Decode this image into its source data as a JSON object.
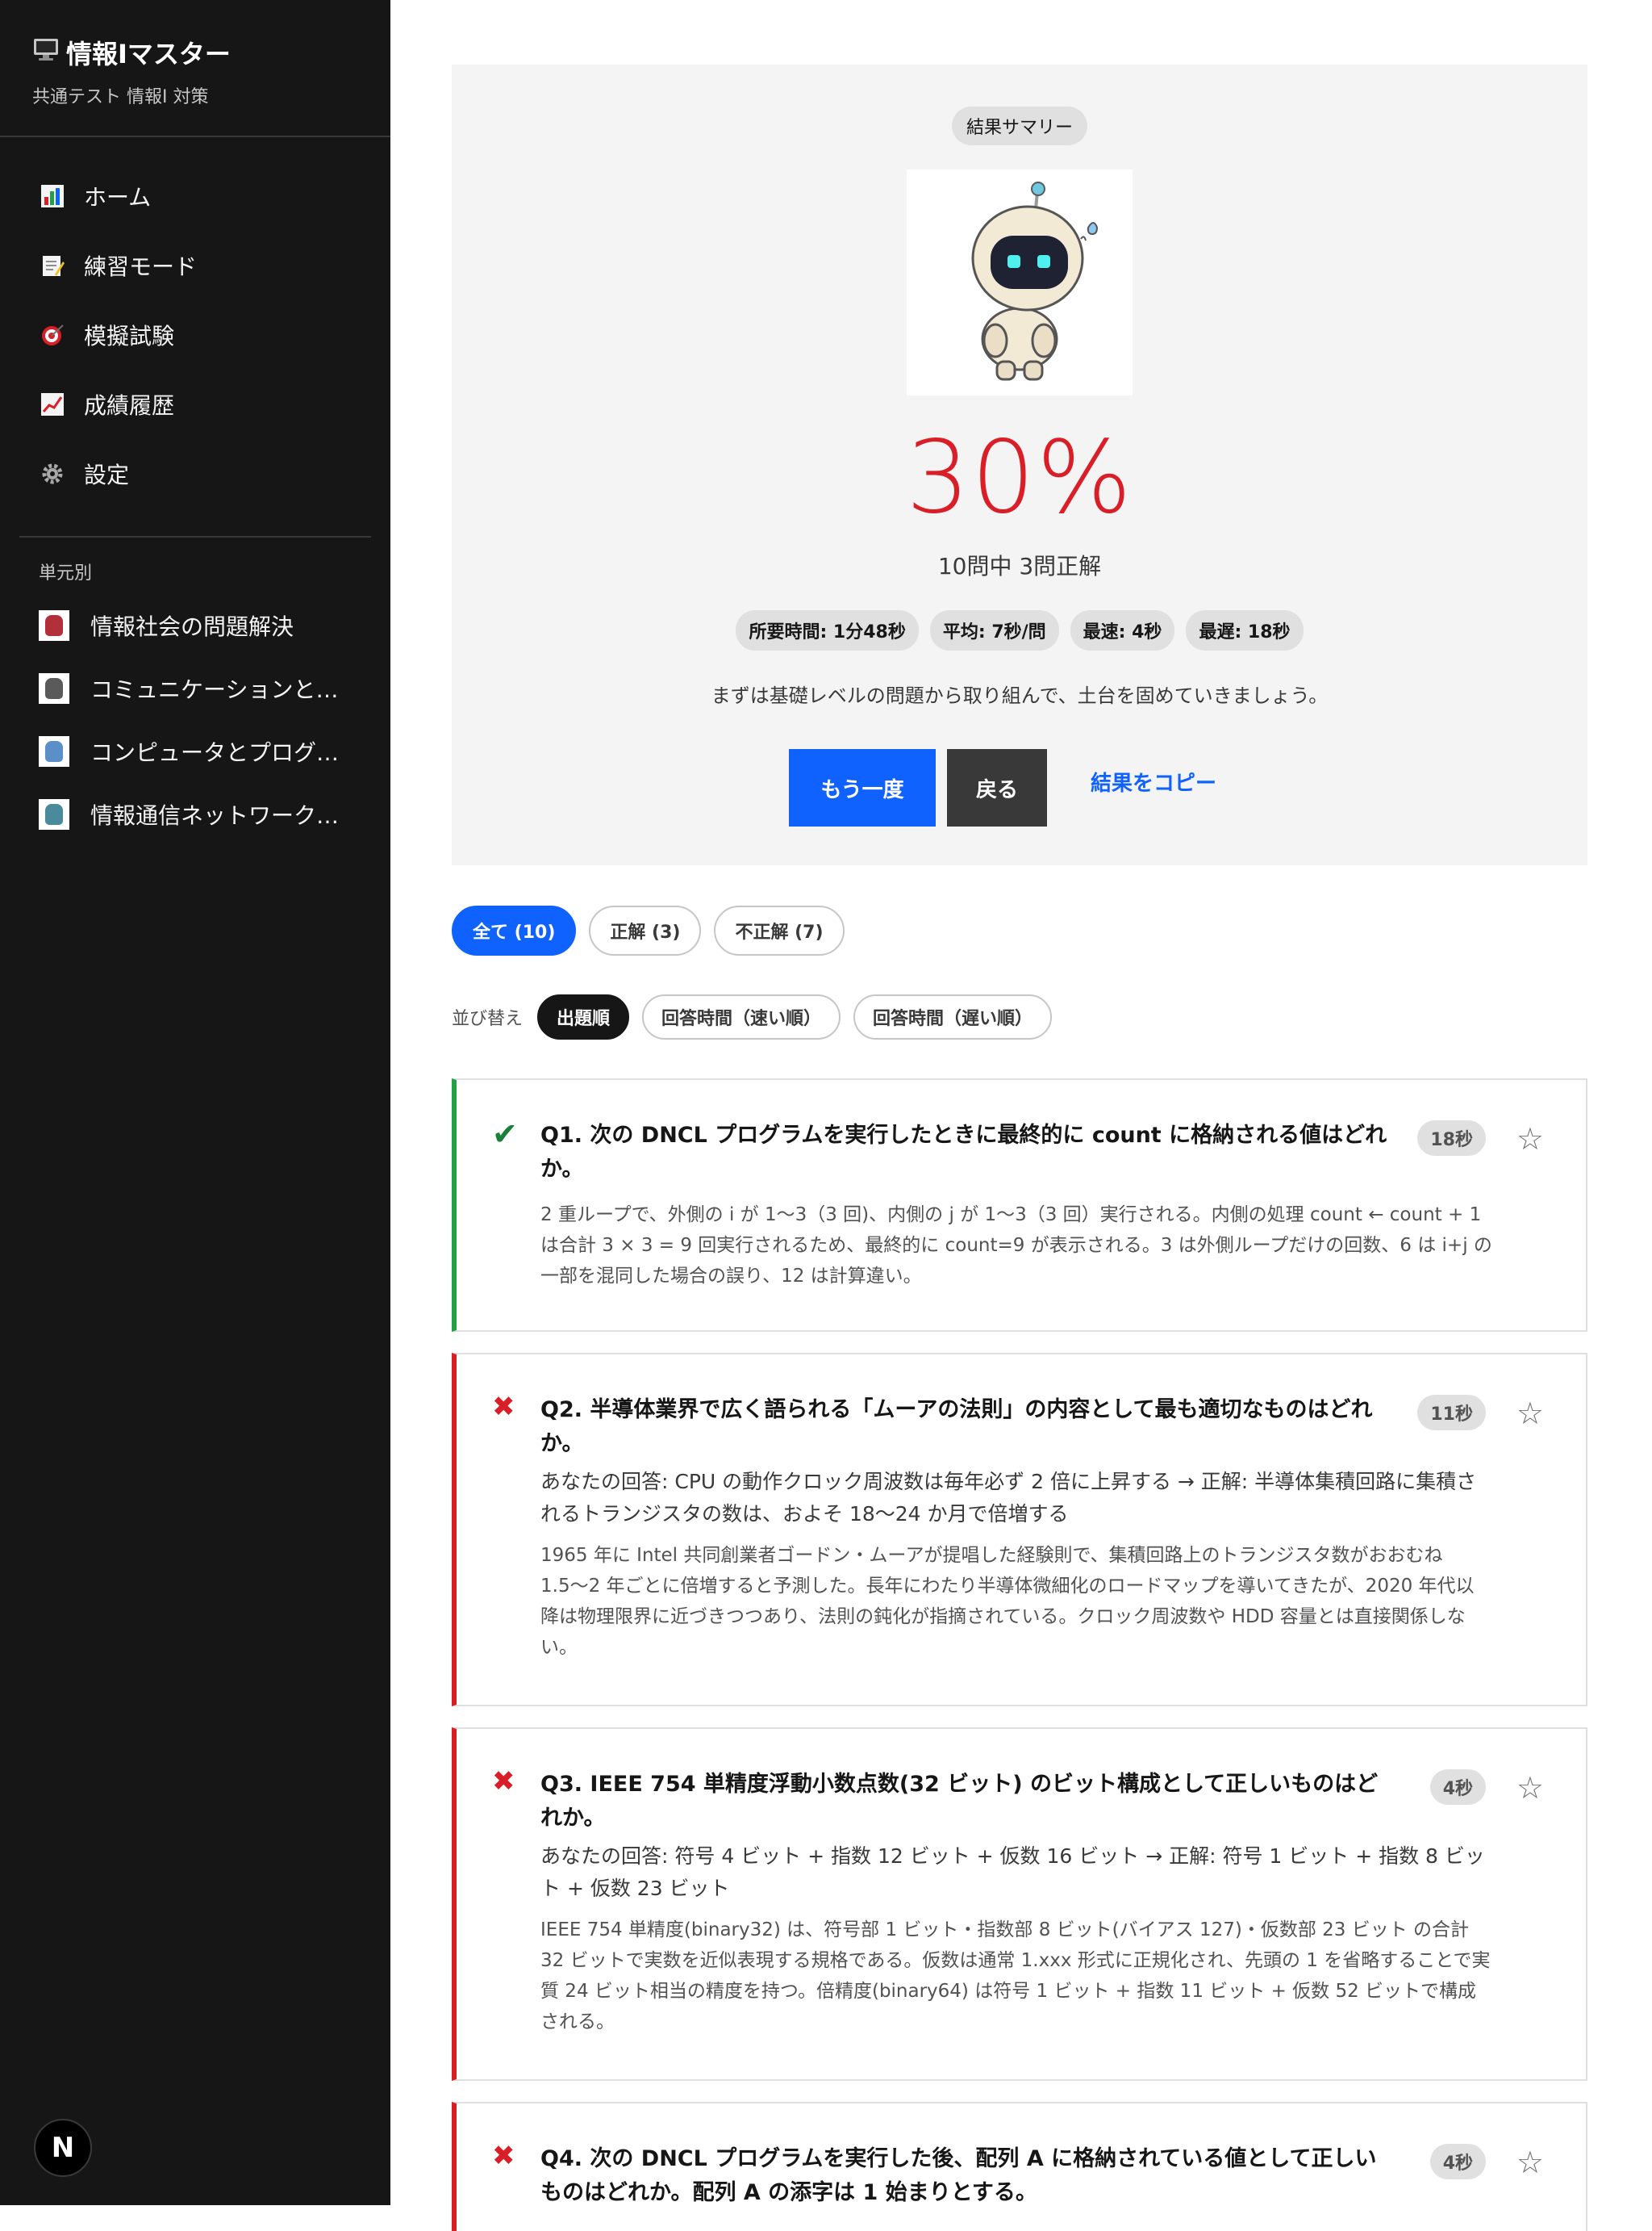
{
  "sidebar": {
    "brand_icon": "monitor-icon",
    "brand_title": "情報Iマスター",
    "brand_subtitle": "共通テスト 情報I 対策",
    "nav": [
      {
        "label": "ホーム",
        "icon": "bar-chart-icon"
      },
      {
        "label": "練習モード",
        "icon": "memo-icon"
      },
      {
        "label": "模擬試験",
        "icon": "target-icon"
      },
      {
        "label": "成績履歴",
        "icon": "line-chart-icon"
      },
      {
        "label": "設定",
        "icon": "gear-icon"
      }
    ],
    "section_label": "単元別",
    "units": [
      {
        "label": "情報社会の問題解決",
        "color": "#b2303a"
      },
      {
        "label": "コミュニケーションと…",
        "color": "#5a5a5a"
      },
      {
        "label": "コンピュータとプログ…",
        "color": "#5b8fc7"
      },
      {
        "label": "情報通信ネットワーク…",
        "color": "#4a8a9a"
      }
    ],
    "footer_badge": "N"
  },
  "summary": {
    "tag": "結果サマリー",
    "score": "30%",
    "score_sub": "10問中 3問正解",
    "stats": [
      "所要時間: 1分48秒",
      "平均: 7秒/問",
      "最速: 4秒",
      "最遅: 18秒"
    ],
    "message": "まずは基礎レベルの問題から取り組んで、土台を固めていきましょう。",
    "retry_label": "もう一度",
    "back_label": "戻る",
    "copy_label": "結果をコピー",
    "score_color": "#da1e28"
  },
  "filters": [
    {
      "label": "全て (10)",
      "active": true
    },
    {
      "label": "正解 (3)",
      "active": false
    },
    {
      "label": "不正解 (7)",
      "active": false
    }
  ],
  "sort": {
    "label": "並び替え",
    "options": [
      {
        "label": "出題順",
        "active": true
      },
      {
        "label": "回答時間（速い順）",
        "active": false
      },
      {
        "label": "回答時間（遅い順）",
        "active": false
      }
    ]
  },
  "questions": [
    {
      "correct": true,
      "mark": "✔",
      "title": "Q1. 次の DNCL プログラムを実行したときに最終的に count に格納される値はどれか。",
      "time": "18秒",
      "answer": "",
      "explanation": "2 重ループで、外側の i が 1〜3（3 回)、内側の j が 1〜3（3 回）実行される。内側の処理 count ← count + 1 は合計 3 × 3 = 9 回実行されるため、最終的に count=9 が表示される。3 は外側ループだけの回数、6 は i+j の一部を混同した場合の誤り、12 は計算違い。"
    },
    {
      "correct": false,
      "mark": "✖",
      "title": "Q2. 半導体業界で広く語られる「ムーアの法則」の内容として最も適切なものはどれか。",
      "time": "11秒",
      "answer": "あなたの回答: CPU の動作クロック周波数は毎年必ず 2 倍に上昇する → 正解: 半導体集積回路に集積されるトランジスタの数は、およそ 18〜24 か月で倍増する",
      "explanation": "1965 年に Intel 共同創業者ゴードン・ムーアが提唱した経験則で、集積回路上のトランジスタ数がおおむね 1.5〜2 年ごとに倍増すると予測した。長年にわたり半導体微細化のロードマップを導いてきたが、2020 年代以降は物理限界に近づきつつあり、法則の鈍化が指摘されている。クロック周波数や HDD 容量とは直接関係しない。"
    },
    {
      "correct": false,
      "mark": "✖",
      "title": "Q3. IEEE 754 単精度浮動小数点数(32 ビット) のビット構成として正しいものはどれか。",
      "time": "4秒",
      "answer": "あなたの回答: 符号 4 ビット + 指数 12 ビット + 仮数 16 ビット → 正解: 符号 1 ビット + 指数 8 ビット + 仮数 23 ビット",
      "explanation": "IEEE 754 単精度(binary32) は、符号部 1 ビット・指数部 8 ビット(バイアス 127)・仮数部 23 ビット の合計 32 ビットで実数を近似表現する規格である。仮数は通常 1.xxx 形式に正規化され、先頭の 1 を省略することで実質 24 ビット相当の精度を持つ。倍精度(binary64) は符号 1 ビット + 指数 11 ビット + 仮数 52 ビットで構成される。"
    },
    {
      "correct": false,
      "mark": "✖",
      "title": "Q4. 次の DNCL プログラムを実行した後、配列 A に格納されている値として正しいものはどれか。配列 A の添字は 1 始まりとする。",
      "time": "4秒",
      "answer": "",
      "explanation": ""
    }
  ]
}
